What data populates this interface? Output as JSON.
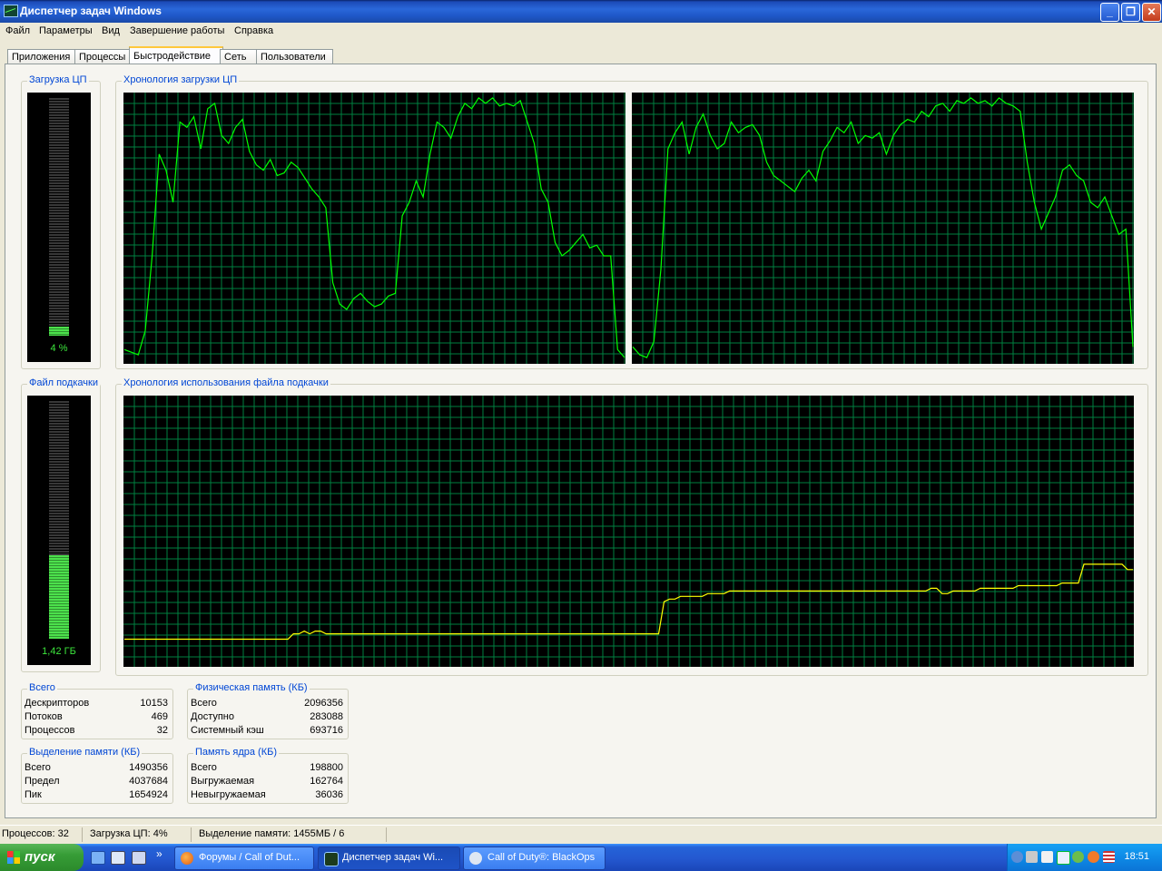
{
  "window": {
    "title": "Диспетчер задач Windows",
    "buttons": {
      "minimize": "_",
      "maximize": "❐",
      "close": "✕"
    }
  },
  "menu": [
    "Файл",
    "Параметры",
    "Вид",
    "Завершение работы",
    "Справка"
  ],
  "tabs": [
    {
      "label": "Приложения",
      "active": false
    },
    {
      "label": "Процессы",
      "active": false
    },
    {
      "label": "Быстродействие",
      "active": true
    },
    {
      "label": "Сеть",
      "active": false
    },
    {
      "label": "Пользователи",
      "active": false
    }
  ],
  "cpu": {
    "group_label": "Загрузка ЦП",
    "value_label": "4 %",
    "percent": 4,
    "history_label": "Хронология загрузки ЦП",
    "history": [
      [
        5,
        4,
        3,
        12,
        40,
        78,
        72,
        60,
        90,
        88,
        92,
        80,
        95,
        97,
        85,
        82,
        88,
        91,
        79,
        74,
        72,
        76,
        70,
        71,
        75,
        73,
        69,
        65,
        62,
        58,
        30,
        22,
        20,
        24,
        26,
        23,
        21,
        22,
        25,
        26,
        55,
        60,
        68,
        62,
        78,
        90,
        88,
        84,
        92,
        97,
        95,
        99,
        97,
        99,
        96,
        97,
        96,
        98,
        90,
        82,
        65,
        60,
        45,
        40,
        42,
        45,
        48,
        43,
        44,
        40,
        40,
        5,
        2
      ],
      [
        6,
        3,
        2,
        8,
        35,
        80,
        86,
        90,
        78,
        88,
        93,
        85,
        80,
        82,
        90,
        86,
        88,
        89,
        85,
        75,
        70,
        68,
        66,
        64,
        69,
        72,
        68,
        79,
        83,
        88,
        86,
        90,
        82,
        85,
        84,
        86,
        78,
        85,
        89,
        91,
        90,
        94,
        92,
        96,
        97,
        94,
        98,
        97,
        99,
        97,
        98,
        96,
        99,
        97,
        96,
        94,
        75,
        60,
        50,
        56,
        62,
        72,
        74,
        70,
        68,
        60,
        58,
        62,
        55,
        48,
        50,
        6
      ]
    ],
    "grid": true
  },
  "pagefile": {
    "group_label": "Файл подкачки",
    "value_label": "1,42 ГБ",
    "fraction": 0.35,
    "history_label": "Хронология использования файла подкачки",
    "history": [
      10,
      10,
      10,
      10,
      10,
      10,
      10,
      10,
      10,
      10,
      10,
      10,
      10,
      10,
      10,
      10,
      10,
      10,
      10,
      10,
      10,
      10,
      10,
      10,
      10,
      10,
      10,
      10,
      10,
      10,
      10,
      12,
      12,
      13,
      12,
      13,
      13,
      12,
      12,
      12,
      12,
      12,
      12,
      12,
      12,
      12,
      12,
      12,
      12,
      12,
      12,
      12,
      12,
      12,
      12,
      12,
      12,
      12,
      12,
      12,
      12,
      12,
      12,
      12,
      12,
      12,
      12,
      12,
      12,
      12,
      12,
      12,
      12,
      12,
      12,
      12,
      12,
      12,
      12,
      12,
      12,
      12,
      12,
      12,
      12,
      12,
      12,
      12,
      12,
      12,
      12,
      12,
      12,
      12,
      12,
      12,
      12,
      12,
      12,
      24,
      25,
      25,
      26,
      26,
      26,
      26,
      26,
      27,
      27,
      27,
      27,
      28,
      28,
      28,
      28,
      28,
      28,
      28,
      28,
      28,
      28,
      28,
      28,
      28,
      28,
      28,
      28,
      28,
      28,
      28,
      28,
      28,
      28,
      28,
      28,
      28,
      28,
      28,
      28,
      28,
      28,
      28,
      28,
      28,
      28,
      28,
      28,
      28,
      29,
      29,
      27,
      27,
      28,
      28,
      28,
      28,
      28,
      29,
      29,
      29,
      29,
      29,
      29,
      29,
      30,
      30,
      30,
      30,
      30,
      30,
      30,
      30,
      31,
      31,
      31,
      31,
      38,
      38,
      38,
      38,
      38,
      38,
      38,
      38,
      36,
      36
    ],
    "grid": true
  },
  "totals": {
    "label": "Всего",
    "rows": [
      {
        "k": "Дескрипторов",
        "v": "10153"
      },
      {
        "k": "Потоков",
        "v": "469"
      },
      {
        "k": "Процессов",
        "v": "32"
      }
    ]
  },
  "physical": {
    "label": "Физическая память (КБ)",
    "rows": [
      {
        "k": "Всего",
        "v": "2096356"
      },
      {
        "k": "Доступно",
        "v": "283088"
      },
      {
        "k": "Системный кэш",
        "v": "693716"
      }
    ]
  },
  "commit": {
    "label": "Выделение памяти (КБ)",
    "rows": [
      {
        "k": "Всего",
        "v": "1490356"
      },
      {
        "k": "Предел",
        "v": "4037684"
      },
      {
        "k": "Пик",
        "v": "1654924"
      }
    ]
  },
  "kernel": {
    "label": "Память ядра (КБ)",
    "rows": [
      {
        "k": "Всего",
        "v": "198800"
      },
      {
        "k": "Выгружаемая",
        "v": "162764"
      },
      {
        "k": "Невыгружаемая",
        "v": "36036"
      }
    ]
  },
  "status": {
    "processes": "Процессов: 32",
    "cpu": "Загрузка ЦП: 4%",
    "commit": "Выделение памяти: 1455МБ / 6"
  },
  "taskbar": {
    "start": "пуск",
    "tasks": [
      {
        "label": "Форумы / Call of Dut...",
        "icon": "firefox-icon",
        "active": false
      },
      {
        "label": "Диспетчер задач Wi...",
        "icon": "task-manager-icon",
        "active": true
      },
      {
        "label": "Call of Duty®: BlackOps",
        "icon": "game-icon",
        "active": false
      }
    ],
    "quicklaunch_more": "»",
    "clock": "18:51"
  },
  "colors": {
    "cpu_line": "#00ff00",
    "pagefile_line": "#ffff00",
    "grid": "#008040",
    "accent": "#0046d5"
  }
}
